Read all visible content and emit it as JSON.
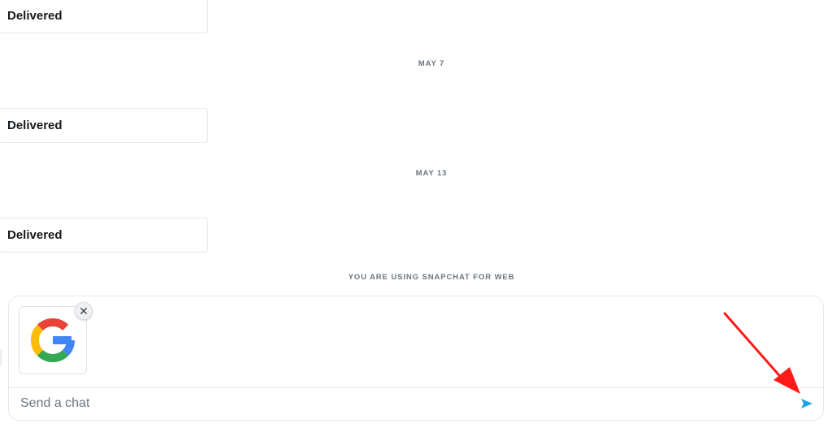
{
  "messages": [
    {
      "status": "Delivered"
    },
    {
      "status": "Delivered"
    },
    {
      "status": "Delivered"
    }
  ],
  "dates": [
    "MAY 7",
    "MAY 13"
  ],
  "notice": "YOU ARE USING SNAPCHAT FOR WEB",
  "composer": {
    "placeholder": "Send a chat",
    "attachment_icon": "google-logo",
    "remove_symbol": "✕",
    "send_icon": "send-arrow-icon"
  },
  "colors": {
    "send": "#1da1f2",
    "annotation_arrow": "#ff1a1a"
  }
}
